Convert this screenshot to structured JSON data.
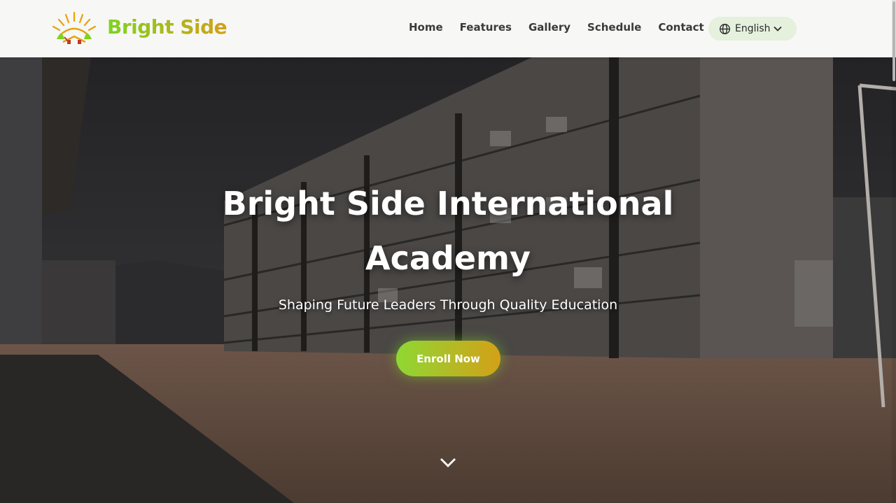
{
  "brand": {
    "name": "Bright Side"
  },
  "nav": {
    "links": [
      "Home",
      "Features",
      "Gallery",
      "Schedule",
      "Contact"
    ],
    "language": "English",
    "language_icon": "globe-icon",
    "theme_icon": "moon-icon"
  },
  "hero": {
    "title": "Bright Side International Academy",
    "subtitle": "Shaping Future Leaders Through Quality Education",
    "cta": "Enroll Now",
    "scroll_icon": "chevron-down-icon"
  },
  "colors": {
    "accent_green": "#7ed321",
    "accent_gold": "#d4a017",
    "navbar_bg": "#f7f7f5",
    "language_pill_bg": "#e5f0dd"
  }
}
